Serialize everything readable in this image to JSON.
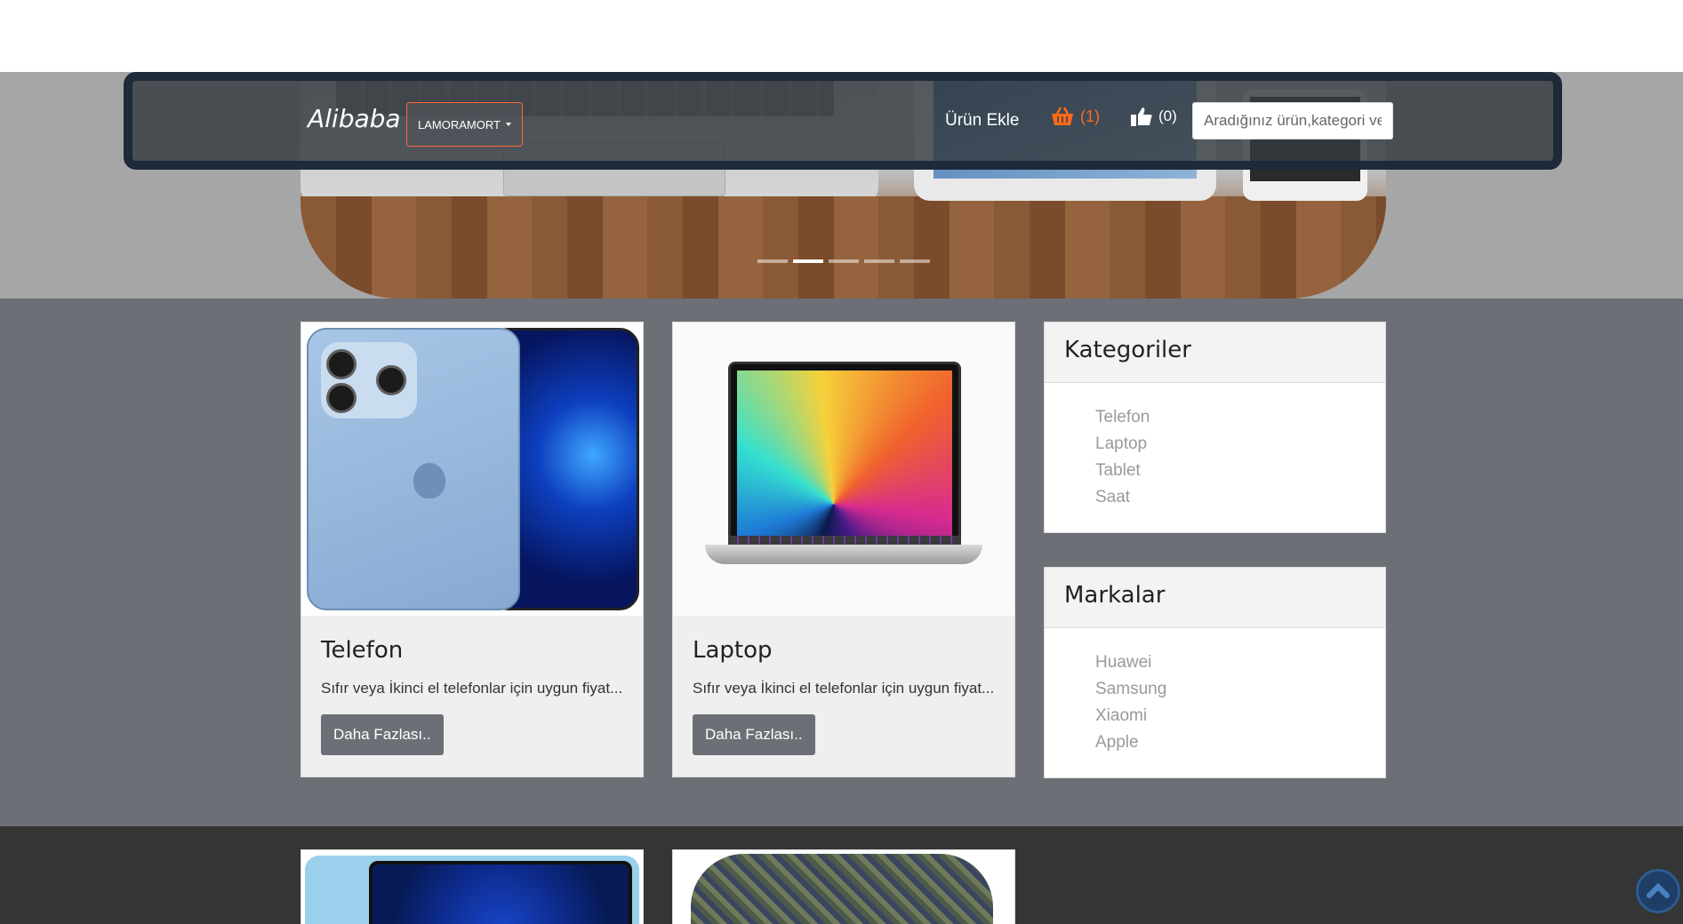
{
  "navbar": {
    "brand": "Alibaba",
    "user_menu_label": "LAMORAMORT",
    "add_product_label": "Ürün Ekle",
    "cart_count": "(1)",
    "likes_count": "(0)",
    "search_placeholder": "Aradığınız ürün,kategori veya markayı yazınız",
    "cart_icon": "basket-icon",
    "likes_icon": "thumbs-up-icon"
  },
  "carousel": {
    "slides": 5,
    "active_index": 1
  },
  "products": [
    {
      "title": "Telefon",
      "description": "Sıfır veya İkinci el telefonlar için uygun fiyat...",
      "button_label": "Daha Fazlası.."
    },
    {
      "title": "Laptop",
      "description": "Sıfır veya İkinci el telefonlar için uygun fiyat...",
      "button_label": "Daha Fazlası.."
    }
  ],
  "sidebar": {
    "categories": {
      "title": "Kategoriler",
      "items": [
        "Telefon",
        "Laptop",
        "Tablet",
        "Saat"
      ]
    },
    "brands": {
      "title": "Markalar",
      "items": [
        "Huawei",
        "Samsung",
        "Xiaomi",
        "Apple"
      ]
    }
  },
  "colors": {
    "accent": "#ff6a1a",
    "navbar_bg": "#343a40",
    "main_bg": "#6c7076",
    "footer_bg": "#353535"
  }
}
